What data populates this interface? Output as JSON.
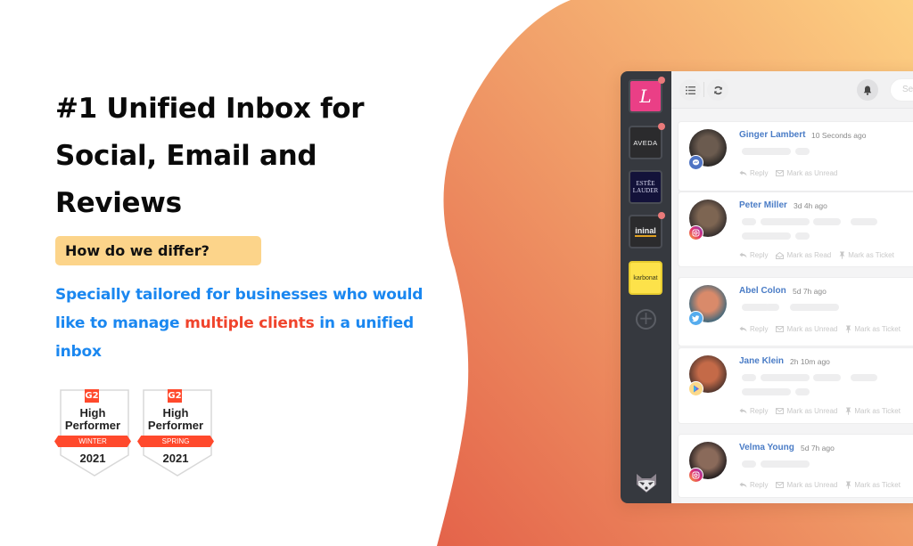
{
  "hero": {
    "headline_lines": [
      "#1 Unified Inbox for",
      "Social, Email and",
      "Reviews"
    ],
    "differ_label": "How do we differ?",
    "tagline_part1": "Specially tailored for businesses who would like to manage ",
    "tagline_highlight": "multiple clients",
    "tagline_part2": " in a unified inbox"
  },
  "badges": [
    {
      "brand": "G2",
      "title_line1": "High",
      "title_line2": "Performer",
      "season": "WINTER",
      "year": "2021"
    },
    {
      "brand": "G2",
      "title_line1": "High",
      "title_line2": "Performer",
      "season": "SPRING",
      "year": "2021"
    }
  ],
  "colors": {
    "headline": "#0a0a0a",
    "badge_bg": "#fcd48a",
    "tagline": "#1a87f0",
    "tagline_highlight": "#f0442c",
    "blob_top": "#fbc77f",
    "blob_bottom": "#e7694b",
    "g2_red": "#ff492c",
    "sidebar": "#36393f",
    "name_link": "#4a7cc6"
  },
  "app": {
    "clients": [
      {
        "name": "L",
        "label": "L",
        "bg": "#ea3f86",
        "fg": "#ffffff",
        "unread": true
      },
      {
        "name": "aveda",
        "label": "AVEDA",
        "bg": "#2b2b2d",
        "fg": "#f2f2f2",
        "unread": true
      },
      {
        "name": "estee-lauder",
        "label1": "ESTĒE",
        "label2": "LAUDER",
        "bg": "#13123a",
        "fg": "#d9d9f0",
        "unread": false
      },
      {
        "name": "ininal",
        "label": "ininal",
        "bg": "#2b2b2d",
        "fg": "#f2f2f2",
        "unread": true
      },
      {
        "name": "karbonat",
        "label": "karbonat",
        "bg": "#fde24a",
        "fg": "#3a3a1a",
        "unread": false
      }
    ],
    "add_client_symbol": "+",
    "search_placeholder": "Se",
    "messages": [
      {
        "name": "Ginger Lambert",
        "time": "10 Seconds ago",
        "channel": "messenger",
        "actions": [
          "Reply",
          "Mark as Unread"
        ]
      },
      {
        "name": "Peter Miller",
        "time": "3d 4h ago",
        "channel": "instagram",
        "actions": [
          "Reply",
          "Mark as Read",
          "Mark as Ticket"
        ]
      },
      {
        "name": "Abel Colon",
        "time": "5d 7h ago",
        "channel": "twitter",
        "actions": [
          "Reply",
          "Mark as Unread",
          "Mark as Ticket"
        ]
      },
      {
        "name": "Jane Klein",
        "time": "2h 10m ago",
        "channel": "google-play",
        "actions": [
          "Reply",
          "Mark as Unread",
          "Mark as Ticket"
        ]
      },
      {
        "name": "Velma Young",
        "time": "5d 7h ago",
        "channel": "instagram",
        "actions": [
          "Reply",
          "Mark as Unread",
          "Mark as Ticket"
        ]
      }
    ]
  }
}
